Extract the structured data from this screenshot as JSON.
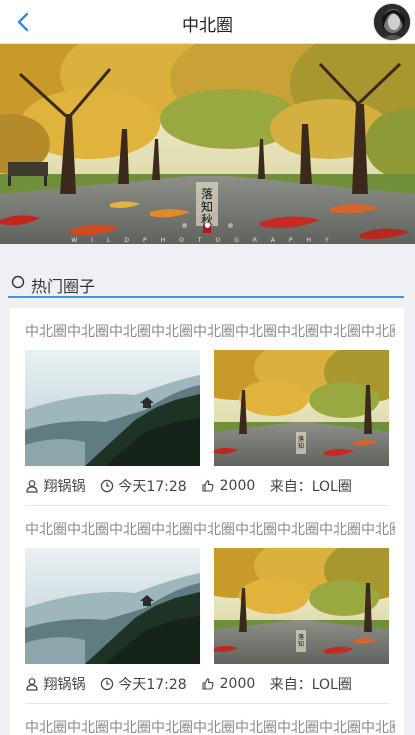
{
  "header": {
    "title": "中北圈",
    "back_icon": "chevron-left-icon",
    "avatar_icon": "user-avatar"
  },
  "banner": {
    "slides": 3,
    "active_index": 1,
    "stamp_text": "落知秋",
    "caption": "WILDPHOTOGRAPHY"
  },
  "section": {
    "title": "热门圈子",
    "icon": "circle-icon",
    "accent": "#3a97e6"
  },
  "posts": [
    {
      "title": "中北圈中北圈中北圈中北圈中北圈中北圈中北圈中北圈中北圈中...",
      "author": "翔锅锅",
      "time": "今天17:28",
      "likes": "2000",
      "source_label": "来自：LOL圈"
    },
    {
      "title": "中北圈中北圈中北圈中北圈中北圈中北圈中北圈中北圈中北圈中...",
      "author": "翔锅锅",
      "time": "今天17:28",
      "likes": "2000",
      "source_label": "来自：LOL圈"
    },
    {
      "title": "中北圈中北圈中北圈中北圈中北圈中北圈中北圈中北圈中北圈中..."
    }
  ]
}
